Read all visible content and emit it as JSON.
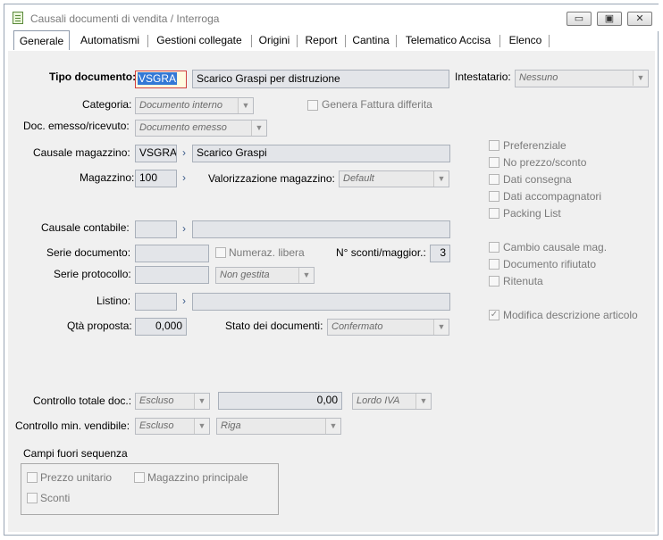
{
  "window": {
    "title": "Causali documenti di vendita / Interroga",
    "min_label": "▭",
    "max_label": "▣",
    "close_label": "✕"
  },
  "tabs": [
    {
      "label": "Generale"
    },
    {
      "label": "Automatismi"
    },
    {
      "label": "Gestioni collegate"
    },
    {
      "label": "Origini"
    },
    {
      "label": "Report"
    },
    {
      "label": "Cantina"
    },
    {
      "label": "Telematico Accisa"
    },
    {
      "label": "Elenco"
    }
  ],
  "form": {
    "tipo_documento": {
      "label": "Tipo documento:",
      "code": "VSGRA",
      "description": "Scarico Graspi per distruzione"
    },
    "intestatario": {
      "label": "Intestatario:",
      "value": "Nessuno"
    },
    "categoria": {
      "label": "Categoria:",
      "value": "Documento interno"
    },
    "genera_fattura": {
      "label": "Genera Fattura differita"
    },
    "doc_emesso": {
      "label": "Doc. emesso/ricevuto:",
      "value": "Documento emesso"
    },
    "causale_magazzino": {
      "label": "Causale magazzino:",
      "code": "VSGRA",
      "description": "Scarico Graspi"
    },
    "magazzino": {
      "label": "Magazzino:",
      "value": "100"
    },
    "valorizzazione": {
      "label": "Valorizzazione magazzino:",
      "value": "Default"
    },
    "causale_contabile": {
      "label": "Causale contabile:",
      "code": "",
      "description": ""
    },
    "serie_documento": {
      "label": "Serie documento:",
      "value": ""
    },
    "numeraz_libera": {
      "label": "Numeraz. libera"
    },
    "n_sconti": {
      "label": "N° sconti/maggior.:",
      "value": "3"
    },
    "serie_protocollo": {
      "label": "Serie protocollo:",
      "value": "",
      "mode": "Non gestita"
    },
    "listino": {
      "label": "Listino:",
      "code": "",
      "description": ""
    },
    "qta_proposta": {
      "label": "Qtà proposta:",
      "value": "0,000"
    },
    "stato_documenti": {
      "label": "Stato dei documenti:",
      "value": "Confermato"
    },
    "controllo_totale": {
      "label": "Controllo totale doc.:",
      "mode": "Escluso",
      "amount": "0,00",
      "basis": "Lordo IVA"
    },
    "controllo_min": {
      "label": "Controllo min. vendibile:",
      "mode": "Escluso",
      "scope": "Riga"
    }
  },
  "checkboxes_right": [
    {
      "label": "Preferenziale",
      "checked": false
    },
    {
      "label": "No prezzo/sconto",
      "checked": false
    },
    {
      "label": "Dati consegna",
      "checked": false
    },
    {
      "label": "Dati accompagnatori",
      "checked": false
    },
    {
      "label": "Packing List",
      "checked": false
    },
    {
      "label": "Cambio causale mag.",
      "checked": false
    },
    {
      "label": "Documento rifiutato",
      "checked": false
    },
    {
      "label": "Ritenuta",
      "checked": false
    },
    {
      "label": "Modifica descrizione articolo",
      "checked": true
    }
  ],
  "campi_fuori_sequenza": {
    "title": "Campi fuori sequenza",
    "prezzo_unitario": "Prezzo unitario",
    "magazzino_principale": "Magazzino principale",
    "sconti": "Sconti"
  },
  "icons": {
    "zoom": "›",
    "dropdown": "▼",
    "check": "✓"
  }
}
